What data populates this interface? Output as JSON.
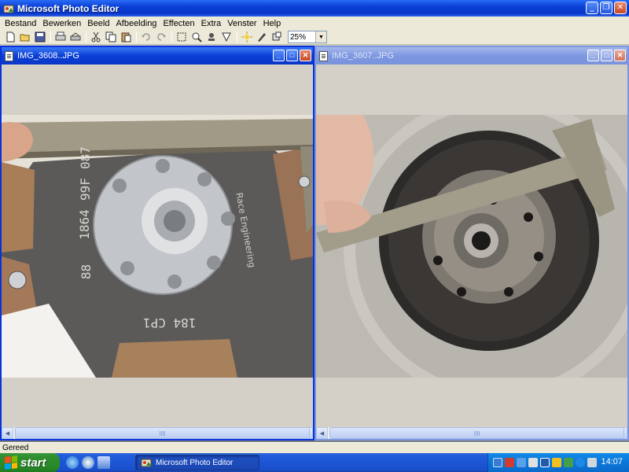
{
  "app": {
    "title": "Microsoft Photo Editor"
  },
  "menu": {
    "items": [
      "Bestand",
      "Bewerken",
      "Beeld",
      "Afbeelding",
      "Effecten",
      "Extra",
      "Venster",
      "Help"
    ]
  },
  "toolbar": {
    "tools": [
      "new-icon",
      "open-icon",
      "save-icon",
      "print-icon",
      "scan-icon",
      "cut-icon",
      "copy-icon",
      "paste-icon",
      "undo-icon",
      "redo-icon",
      "select-icon",
      "zoom-icon",
      "smudge-icon",
      "sharpen-icon",
      "balance-icon",
      "eraser-icon",
      "crop-icon"
    ],
    "zoom_value": "25%"
  },
  "windows": [
    {
      "title": "IMG_3608..JPG",
      "active": true
    },
    {
      "title": "IMG_3607..JPG",
      "active": false
    }
  ],
  "photo_text": {
    "disc_print_1": "88",
    "disc_print_2": "1864",
    "disc_print_3": "99F",
    "disc_print_4": "087",
    "disc_print_5": "184 CP1",
    "disc_print_6": "Race Engineering"
  },
  "status": {
    "text": "Gereed"
  },
  "taskbar": {
    "start_label": "start",
    "task_label": "Microsoft Photo Editor",
    "clock": "14:07",
    "colors": {
      "start": "#2f8e2f",
      "bar": "#245edb",
      "tray": "#0c77d8"
    }
  }
}
